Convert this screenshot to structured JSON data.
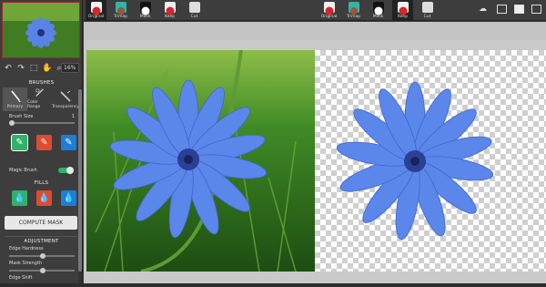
{
  "toolbar": {
    "zoom": "16%",
    "left_group": [
      {
        "label": "Original",
        "icon": "original-icon",
        "color": "#d9232e"
      },
      {
        "label": "Trimap",
        "icon": "trimap-icon",
        "color": "#33b4a5"
      },
      {
        "label": "Mask",
        "icon": "mask-icon",
        "color": "#ffffff"
      },
      {
        "label": "Keep",
        "icon": "keep-icon",
        "color": "#d9232e"
      },
      {
        "label": "Cut",
        "icon": "cut-icon",
        "color": "#dddddd"
      }
    ],
    "right_group": [
      {
        "label": "Original",
        "icon": "original-icon",
        "color": "#d9232e"
      },
      {
        "label": "Trimap",
        "icon": "trimap-icon",
        "color": "#33b4a5"
      },
      {
        "label": "Mask",
        "icon": "mask-icon",
        "color": "#ffffff"
      },
      {
        "label": "Keep",
        "icon": "keep-icon",
        "color": "#d9232e"
      },
      {
        "label": "Cut",
        "icon": "cut-icon",
        "color": "#dddddd"
      }
    ]
  },
  "panel": {
    "brushes_title": "BRUSHES",
    "brush_tools": [
      "Primary",
      "Color Range",
      "Transparency"
    ],
    "brush_size_label": "Brush Size",
    "brush_size_value": "1",
    "magic_brush_label": "Magic Brush",
    "magic_brush_on": true,
    "fills_title": "FILLS",
    "compute_label": "COMPUTE MASK",
    "adjustment_title": "ADJUSTMENT",
    "edge_hardness_label": "Edge Hardness",
    "mask_strength_label": "Mask Strength",
    "edge_shift_label": "Edge Shift"
  },
  "colors": {
    "keep_green": "#2eb36a",
    "remove_red": "#e04a2f",
    "transparency_blue": "#1c7fd6",
    "flower_blue": "#4d7be8"
  }
}
